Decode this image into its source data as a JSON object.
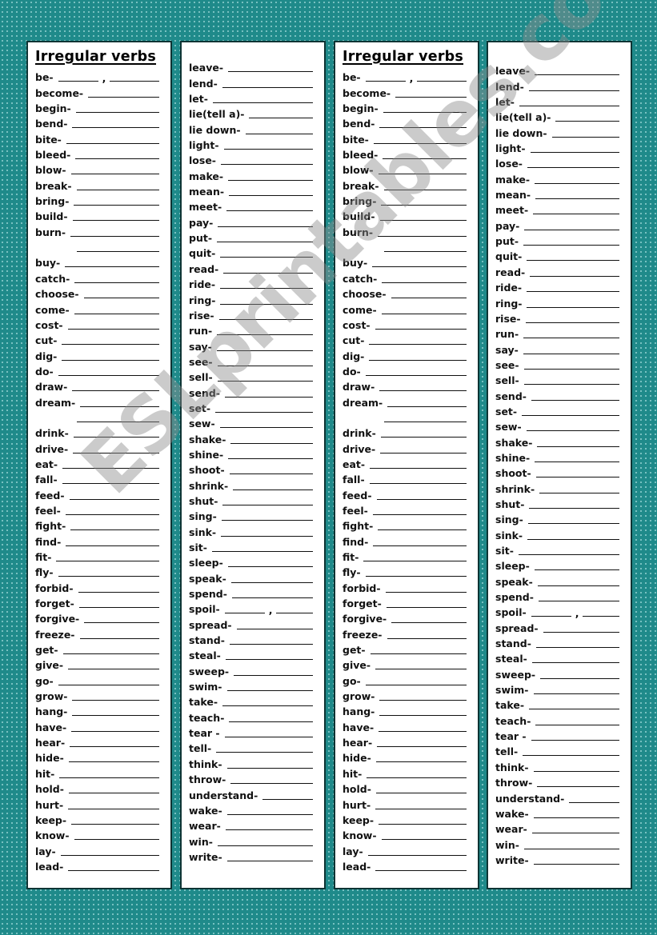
{
  "title": "Irregular verbs",
  "watermark": "ESLprintables.com",
  "colors": {
    "background": "#1f8a8a",
    "panel": "#ffffff",
    "border": "#0e3434",
    "text": "#111111"
  },
  "list_a": [
    {
      "verb": "be-",
      "split": true
    },
    {
      "verb": "become-"
    },
    {
      "verb": "begin-"
    },
    {
      "verb": "bend-"
    },
    {
      "verb": "bite-"
    },
    {
      "verb": "bleed-"
    },
    {
      "verb": "blow-"
    },
    {
      "verb": "break-"
    },
    {
      "verb": "bring-"
    },
    {
      "verb": "build-"
    },
    {
      "verb": "burn-"
    },
    {
      "verb": "",
      "spacer": true
    },
    {
      "verb": "buy-"
    },
    {
      "verb": "catch-"
    },
    {
      "verb": "choose-"
    },
    {
      "verb": "come-"
    },
    {
      "verb": "cost-"
    },
    {
      "verb": "cut-"
    },
    {
      "verb": "dig-"
    },
    {
      "verb": "do-"
    },
    {
      "verb": "draw-"
    },
    {
      "verb": "dream-"
    },
    {
      "verb": "",
      "spacer": true
    },
    {
      "verb": "drink-"
    },
    {
      "verb": "drive-"
    },
    {
      "verb": "eat-"
    },
    {
      "verb": "fall-"
    },
    {
      "verb": "feed-"
    },
    {
      "verb": "feel-"
    },
    {
      "verb": "fight-"
    },
    {
      "verb": "find-"
    },
    {
      "verb": "fit-"
    },
    {
      "verb": "fly-"
    },
    {
      "verb": "forbid-"
    },
    {
      "verb": "forget-"
    },
    {
      "verb": "forgive-"
    },
    {
      "verb": "freeze-"
    },
    {
      "verb": "get-"
    },
    {
      "verb": "give-"
    },
    {
      "verb": "go-"
    },
    {
      "verb": "grow-"
    },
    {
      "verb": "hang-"
    },
    {
      "verb": "have-"
    },
    {
      "verb": "hear-"
    },
    {
      "verb": "hide-"
    },
    {
      "verb": "hit-"
    },
    {
      "verb": "hold-"
    },
    {
      "verb": "hurt-"
    },
    {
      "verb": "keep-"
    },
    {
      "verb": "know-"
    },
    {
      "verb": "lay-"
    },
    {
      "verb": "lead-"
    }
  ],
  "list_b": [
    {
      "verb": "leave-"
    },
    {
      "verb": "lend-"
    },
    {
      "verb": "let-"
    },
    {
      "verb": "lie(tell a)-"
    },
    {
      "verb": "lie down-"
    },
    {
      "verb": "light-"
    },
    {
      "verb": "lose-"
    },
    {
      "verb": "make-"
    },
    {
      "verb": "mean-"
    },
    {
      "verb": "meet-"
    },
    {
      "verb": "pay-"
    },
    {
      "verb": "put-"
    },
    {
      "verb": "quit-"
    },
    {
      "verb": "read-"
    },
    {
      "verb": "ride-"
    },
    {
      "verb": "ring-"
    },
    {
      "verb": "rise-"
    },
    {
      "verb": "run-"
    },
    {
      "verb": "say-"
    },
    {
      "verb": "see-"
    },
    {
      "verb": "sell-"
    },
    {
      "verb": "send-"
    },
    {
      "verb": "set-"
    },
    {
      "verb": "sew-"
    },
    {
      "verb": "shake-"
    },
    {
      "verb": "shine-"
    },
    {
      "verb": "shoot-"
    },
    {
      "verb": "shrink-"
    },
    {
      "verb": "shut-"
    },
    {
      "verb": "sing-"
    },
    {
      "verb": "sink-"
    },
    {
      "verb": "sit-"
    },
    {
      "verb": "sleep-"
    },
    {
      "verb": "speak-"
    },
    {
      "verb": "spend-"
    },
    {
      "verb": "spoil-",
      "split": true
    },
    {
      "verb": "spread-"
    },
    {
      "verb": "stand-"
    },
    {
      "verb": "steal-"
    },
    {
      "verb": "sweep-"
    },
    {
      "verb": "swim-"
    },
    {
      "verb": "take-"
    },
    {
      "verb": "teach-"
    },
    {
      "verb": "tear -"
    },
    {
      "verb": "tell-"
    },
    {
      "verb": "think-"
    },
    {
      "verb": "throw-"
    },
    {
      "verb": "understand-"
    },
    {
      "verb": "wake-"
    },
    {
      "verb": "wear-"
    },
    {
      "verb": "win-"
    },
    {
      "verb": "write-"
    }
  ]
}
